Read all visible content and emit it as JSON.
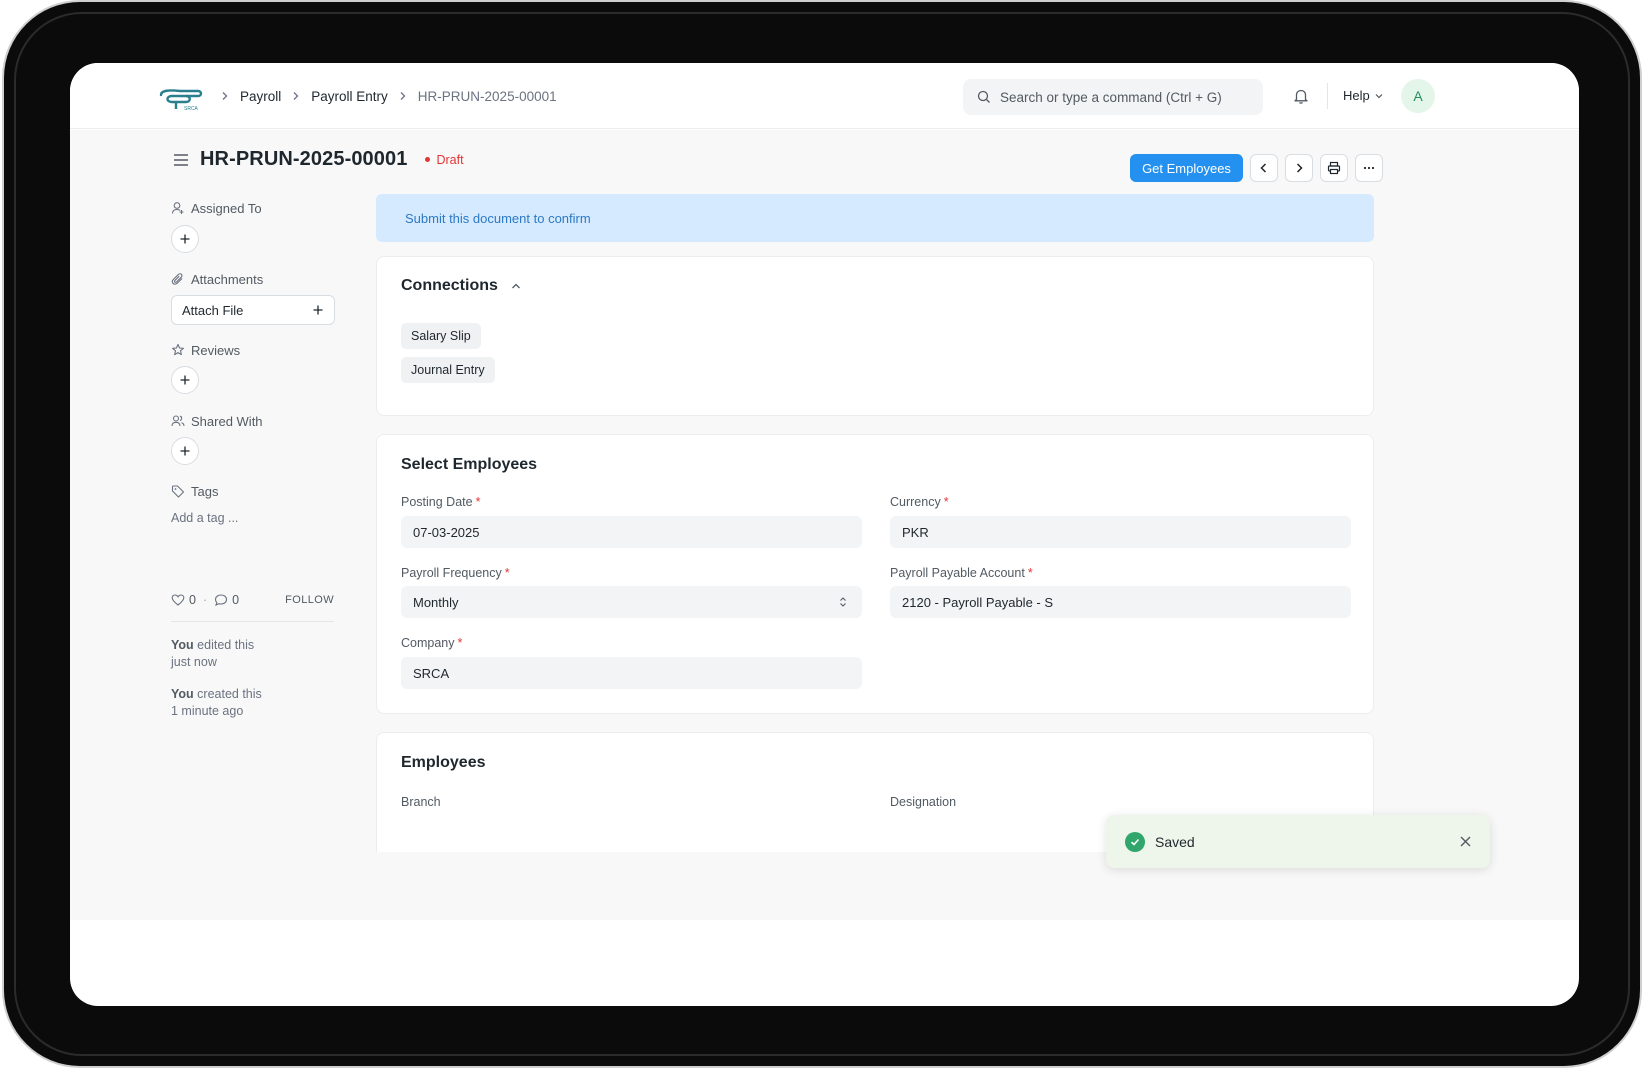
{
  "breadcrumbs": [
    "Payroll",
    "Payroll Entry",
    "HR-PRUN-2025-00001"
  ],
  "search": {
    "placeholder": "Search or type a command (Ctrl + G)"
  },
  "help_label": "Help",
  "avatar_initial": "A",
  "doc": {
    "title": "HR-PRUN-2025-00001",
    "status": "Draft",
    "status_color": "#e03636"
  },
  "toolbar": {
    "get_employees_label": "Get Employees"
  },
  "sidebar": {
    "assigned_to": "Assigned To",
    "attachments": "Attachments",
    "attach_file": "Attach File",
    "reviews": "Reviews",
    "shared_with": "Shared With",
    "tags": "Tags",
    "add_tag": "Add a tag ...",
    "likes": "0",
    "comments": "0",
    "follow": "FOLLOW",
    "activity": [
      {
        "who": "You",
        "what": " edited this",
        "when": "just now"
      },
      {
        "who": "You",
        "what": " created this",
        "when": "1 minute ago"
      }
    ]
  },
  "alert": {
    "text": "Submit this document to confirm",
    "color": "#d5eaff"
  },
  "connections": {
    "title": "Connections",
    "links": [
      "Salary Slip",
      "Journal Entry"
    ]
  },
  "select_employees": {
    "title": "Select Employees",
    "fields": {
      "posting_date": {
        "label": "Posting Date",
        "value": "07-03-2025"
      },
      "currency": {
        "label": "Currency",
        "value": "PKR"
      },
      "payroll_frequency": {
        "label": "Payroll Frequency",
        "value": "Monthly"
      },
      "payroll_payable_account": {
        "label": "Payroll Payable Account",
        "value": "2120 - Payroll Payable - S"
      },
      "company": {
        "label": "Company",
        "value": "SRCA"
      }
    }
  },
  "employees": {
    "title": "Employees",
    "branch_label": "Branch",
    "designation_label": "Designation"
  },
  "toast": {
    "text": "Saved",
    "color": "#30a66d"
  },
  "primary_color": "#2490ef"
}
